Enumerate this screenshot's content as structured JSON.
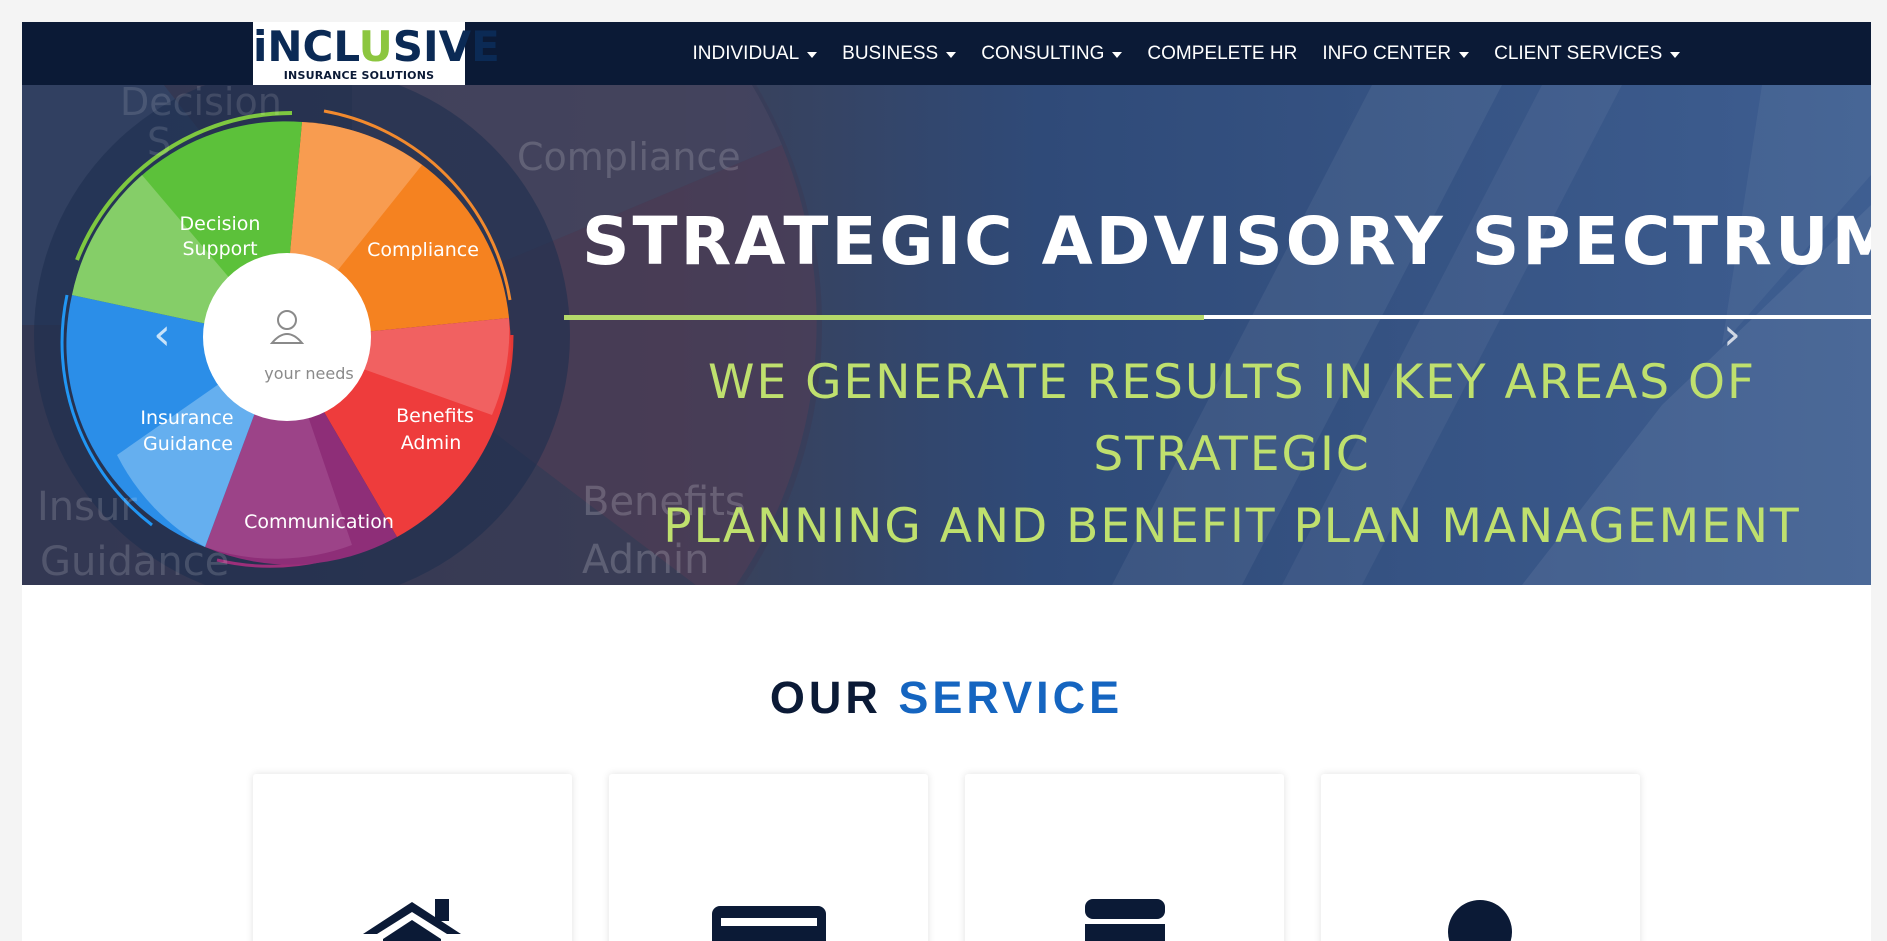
{
  "logo": {
    "word_prefix": "iNCL",
    "word_u": "U",
    "word_suffix": "SIVE",
    "subtitle": "INSURANCE SOLUTIONS"
  },
  "nav": {
    "items": [
      {
        "label": "INDIVIDUAL",
        "dropdown": true
      },
      {
        "label": "BUSINESS",
        "dropdown": true
      },
      {
        "label": "CONSULTING",
        "dropdown": true
      },
      {
        "label": "COMPELETE HR",
        "dropdown": false
      },
      {
        "label": "INFO CENTER",
        "dropdown": true
      },
      {
        "label": "CLIENT SERVICES",
        "dropdown": true
      }
    ]
  },
  "hero": {
    "title": "STRATEGIC ADVISORY SPECTRUM",
    "subtitle_line1": "WE GENERATE RESULTS IN KEY AREAS OF STRATEGIC",
    "subtitle_line2": "PLANNING AND BENEFIT PLAN MANAGEMENT",
    "wheel_center": "your needs",
    "wheel_segments": {
      "decision_1": "Decision",
      "decision_2": "Support",
      "compliance": "Compliance",
      "benefits_1": "Benefits",
      "benefits_2": "Admin",
      "communication": "Communication",
      "insurance_1": "Insurance",
      "insurance_2": "Guidance"
    },
    "bg_labels": {
      "decision": "Decision",
      "decision_s": "S",
      "compliance": "Compliance",
      "benefits": "Benefits",
      "admin": "Admin",
      "insur": "Insur",
      "guidance": "Guidance"
    },
    "prev_glyph": "‹",
    "next_glyph": "›"
  },
  "services": {
    "title_a": "OUR ",
    "title_b": "SERVICE",
    "cards": [
      {
        "icon": "home-icon"
      },
      {
        "icon": "credit-card-icon"
      },
      {
        "icon": "wallet-icon"
      },
      {
        "icon": "user-icon"
      }
    ]
  },
  "colors": {
    "navbar": "#0b1a36",
    "accent_blue": "#1565c0",
    "hero_green": "#bfe06e"
  }
}
